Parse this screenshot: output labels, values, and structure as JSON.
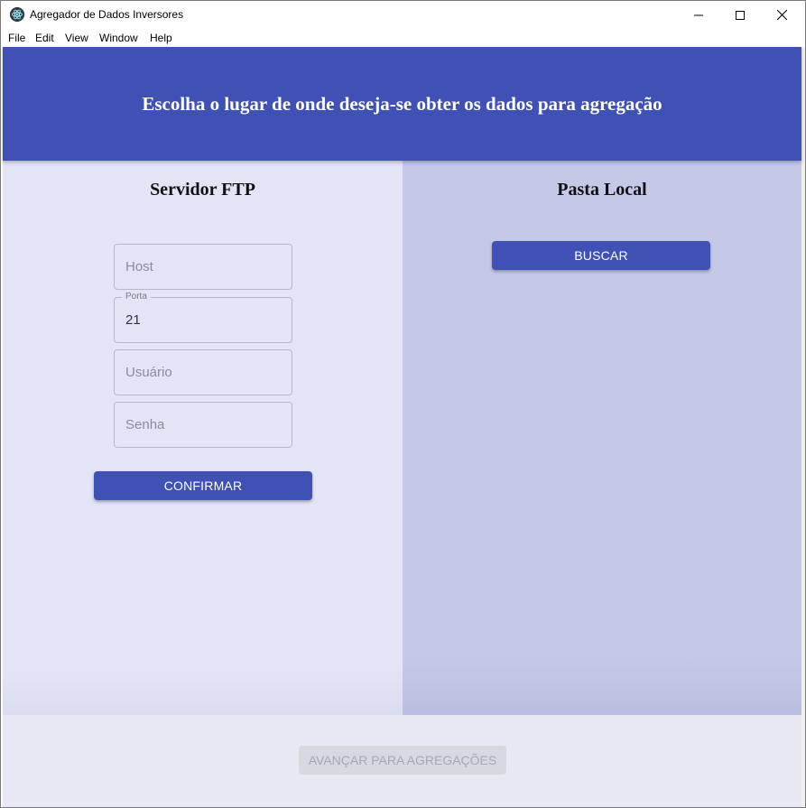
{
  "window": {
    "title": "Agregador de Dados Inversores"
  },
  "menubar": {
    "items": [
      "File",
      "Edit",
      "View",
      "Window",
      "Help"
    ]
  },
  "header": {
    "title": "Escolha o lugar de onde deseja-se obter os dados para agregação",
    "color": "#3f51b5"
  },
  "ftp": {
    "title": "Servidor FTP",
    "host_placeholder": "Host",
    "port_label": "Porta",
    "port_value": "21",
    "user_placeholder": "Usuário",
    "password_placeholder": "Senha",
    "confirm_label": "CONFIRMAR"
  },
  "local": {
    "title": "Pasta Local",
    "search_label": "BUSCAR"
  },
  "footer": {
    "next_label": "AVANÇAR PARA AGREGAÇÕES",
    "next_disabled": true
  }
}
